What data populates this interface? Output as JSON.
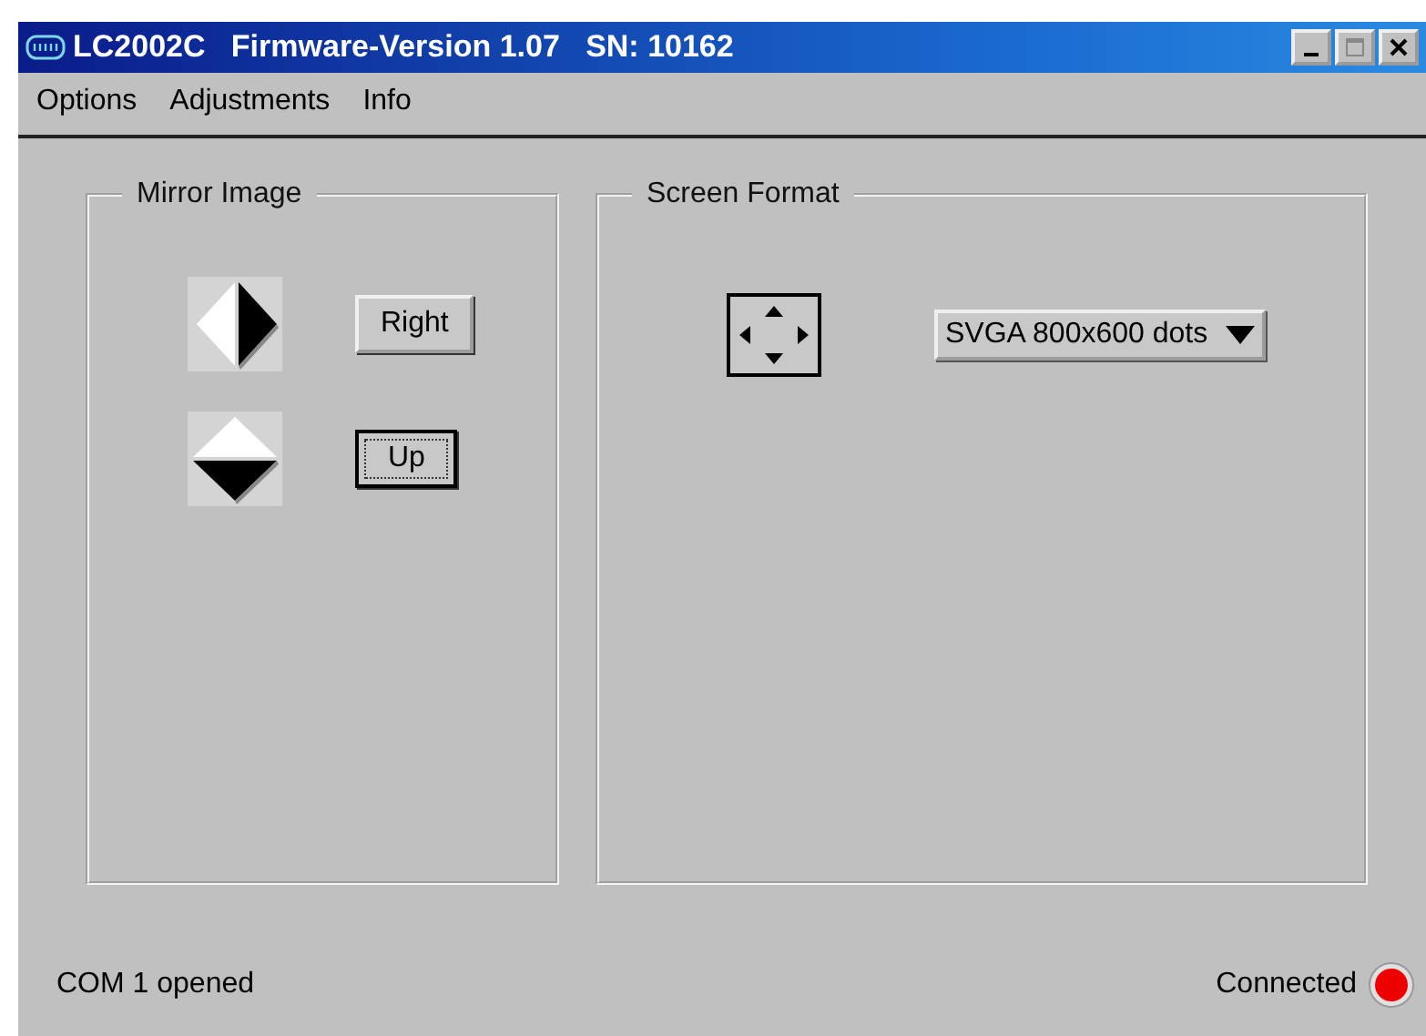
{
  "window": {
    "title": "LC2002C   Firmware-Version 1.07   SN: 10162"
  },
  "menu": [
    "Options",
    "Adjustments",
    "Info"
  ],
  "mirror_image": {
    "title": "Mirror Image",
    "rows": [
      {
        "kind": "horizontal",
        "button": "Right",
        "focused": false
      },
      {
        "kind": "vertical",
        "button": "Up",
        "focused": true
      }
    ]
  },
  "screen_format": {
    "title": "Screen Format",
    "dropdown": "SVGA 800x600 dots"
  },
  "status_bar": {
    "port": "COM 1 opened",
    "connection": "Connected",
    "color": "#ee0000"
  }
}
